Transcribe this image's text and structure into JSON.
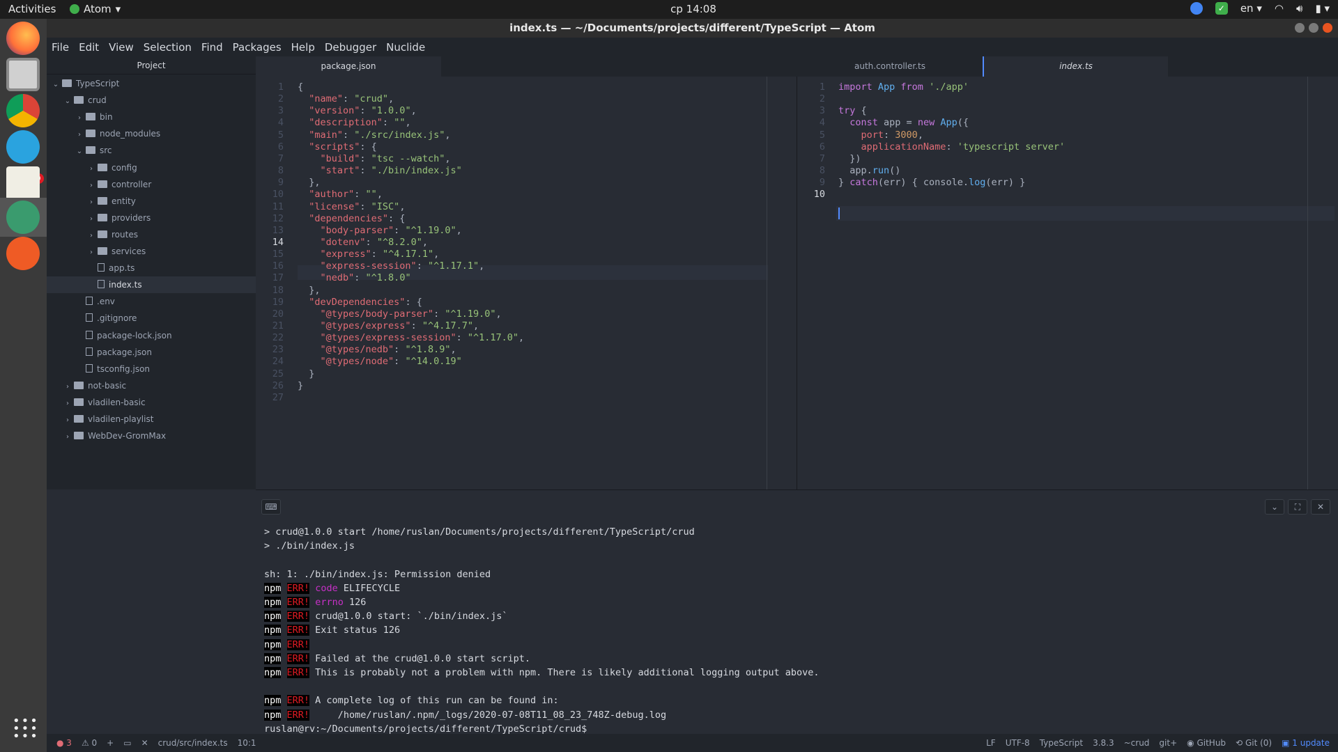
{
  "topbar": {
    "activities": "Activities",
    "app": "Atom",
    "clock": "ср 14:08",
    "lang": "en"
  },
  "window": {
    "title": "index.ts — ~/Documents/projects/different/TypeScript — Atom"
  },
  "dock": {
    "badge": "9999"
  },
  "menu": [
    "File",
    "Edit",
    "View",
    "Selection",
    "Find",
    "Packages",
    "Help",
    "Debugger",
    "Nuclide"
  ],
  "tree": {
    "header": "Project",
    "items": [
      {
        "label": "TypeScript",
        "depth": 0,
        "type": "folder",
        "open": true
      },
      {
        "label": "crud",
        "depth": 1,
        "type": "folder",
        "open": true
      },
      {
        "label": "bin",
        "depth": 2,
        "type": "folder",
        "open": false
      },
      {
        "label": "node_modules",
        "depth": 2,
        "type": "folder",
        "open": false
      },
      {
        "label": "src",
        "depth": 2,
        "type": "folder",
        "open": true
      },
      {
        "label": "config",
        "depth": 3,
        "type": "folder",
        "open": false
      },
      {
        "label": "controller",
        "depth": 3,
        "type": "folder",
        "open": false
      },
      {
        "label": "entity",
        "depth": 3,
        "type": "folder",
        "open": false
      },
      {
        "label": "providers",
        "depth": 3,
        "type": "folder",
        "open": false
      },
      {
        "label": "routes",
        "depth": 3,
        "type": "folder",
        "open": false
      },
      {
        "label": "services",
        "depth": 3,
        "type": "folder",
        "open": false
      },
      {
        "label": "app.ts",
        "depth": 3,
        "type": "file"
      },
      {
        "label": "index.ts",
        "depth": 3,
        "type": "file",
        "selected": true
      },
      {
        "label": ".env",
        "depth": 2,
        "type": "file"
      },
      {
        "label": ".gitignore",
        "depth": 2,
        "type": "file"
      },
      {
        "label": "package-lock.json",
        "depth": 2,
        "type": "file"
      },
      {
        "label": "package.json",
        "depth": 2,
        "type": "file"
      },
      {
        "label": "tsconfig.json",
        "depth": 2,
        "type": "file"
      },
      {
        "label": "not-basic",
        "depth": 1,
        "type": "folder",
        "open": false
      },
      {
        "label": "vladilen-basic",
        "depth": 1,
        "type": "folder",
        "open": false
      },
      {
        "label": "vladilen-playlist",
        "depth": 1,
        "type": "folder",
        "open": false
      },
      {
        "label": "WebDev-GromMax",
        "depth": 1,
        "type": "folder",
        "open": false
      }
    ]
  },
  "tabs": {
    "pane1": [
      "package.json"
    ],
    "pane2": [
      "auth.controller.ts",
      "index.ts"
    ]
  },
  "editor1": {
    "lines": [
      [
        [
          "{",
          "w"
        ]
      ],
      [
        [
          "  \"name\"",
          "p"
        ],
        [
          ": ",
          "w"
        ],
        [
          "\"crud\"",
          "s"
        ],
        [
          ",",
          "w"
        ]
      ],
      [
        [
          "  \"version\"",
          "p"
        ],
        [
          ": ",
          "w"
        ],
        [
          "\"1.0.0\"",
          "s"
        ],
        [
          ",",
          "w"
        ]
      ],
      [
        [
          "  \"description\"",
          "p"
        ],
        [
          ": ",
          "w"
        ],
        [
          "\"\"",
          "s"
        ],
        [
          ",",
          "w"
        ]
      ],
      [
        [
          "  \"main\"",
          "p"
        ],
        [
          ": ",
          "w"
        ],
        [
          "\"./src/index.js\"",
          "s"
        ],
        [
          ",",
          "w"
        ]
      ],
      [
        [
          "  \"scripts\"",
          "p"
        ],
        [
          ": {",
          "w"
        ]
      ],
      [
        [
          "    \"build\"",
          "p"
        ],
        [
          ": ",
          "w"
        ],
        [
          "\"tsc --watch\"",
          "s"
        ],
        [
          ",",
          "w"
        ]
      ],
      [
        [
          "    \"start\"",
          "p"
        ],
        [
          ": ",
          "w"
        ],
        [
          "\"./bin/index.js\"",
          "s"
        ]
      ],
      [
        [
          "  },",
          "w"
        ]
      ],
      [
        [
          "  \"author\"",
          "p"
        ],
        [
          ": ",
          "w"
        ],
        [
          "\"\"",
          "s"
        ],
        [
          ",",
          "w"
        ]
      ],
      [
        [
          "  \"license\"",
          "p"
        ],
        [
          ": ",
          "w"
        ],
        [
          "\"ISC\"",
          "s"
        ],
        [
          ",",
          "w"
        ]
      ],
      [
        [
          "  \"dependencies\"",
          "p"
        ],
        [
          ": {",
          "w"
        ]
      ],
      [
        [
          "    \"body-parser\"",
          "p"
        ],
        [
          ": ",
          "w"
        ],
        [
          "\"^1.19.0\"",
          "s"
        ],
        [
          ",",
          "w"
        ]
      ],
      [
        [
          "    \"dotenv\"",
          "p"
        ],
        [
          ": ",
          "w"
        ],
        [
          "\"^8.2.0\"",
          "s"
        ],
        [
          ",",
          "w"
        ]
      ],
      [
        [
          "    \"express\"",
          "p"
        ],
        [
          ": ",
          "w"
        ],
        [
          "\"^4.17.1\"",
          "s"
        ],
        [
          ",",
          "w"
        ]
      ],
      [
        [
          "    \"express-session\"",
          "p"
        ],
        [
          ": ",
          "w"
        ],
        [
          "\"^1.17.1\"",
          "s"
        ],
        [
          ",",
          "w"
        ]
      ],
      [
        [
          "    \"nedb\"",
          "p"
        ],
        [
          ": ",
          "w"
        ],
        [
          "\"^1.8.0\"",
          "s"
        ]
      ],
      [
        [
          "  },",
          "w"
        ]
      ],
      [
        [
          "  \"devDependencies\"",
          "p"
        ],
        [
          ": {",
          "w"
        ]
      ],
      [
        [
          "    \"@types/body-parser\"",
          "p"
        ],
        [
          ": ",
          "w"
        ],
        [
          "\"^1.19.0\"",
          "s"
        ],
        [
          ",",
          "w"
        ]
      ],
      [
        [
          "    \"@types/express\"",
          "p"
        ],
        [
          ": ",
          "w"
        ],
        [
          "\"^4.17.7\"",
          "s"
        ],
        [
          ",",
          "w"
        ]
      ],
      [
        [
          "    \"@types/express-session\"",
          "p"
        ],
        [
          ": ",
          "w"
        ],
        [
          "\"^1.17.0\"",
          "s"
        ],
        [
          ",",
          "w"
        ]
      ],
      [
        [
          "    \"@types/nedb\"",
          "p"
        ],
        [
          ": ",
          "w"
        ],
        [
          "\"^1.8.9\"",
          "s"
        ],
        [
          ",",
          "w"
        ]
      ],
      [
        [
          "    \"@types/node\"",
          "p"
        ],
        [
          ": ",
          "w"
        ],
        [
          "\"^14.0.19\"",
          "s"
        ]
      ],
      [
        [
          "  }",
          "w"
        ]
      ],
      [
        [
          "}",
          "w"
        ]
      ],
      [
        [
          "",
          "w"
        ]
      ]
    ]
  },
  "editor2": {
    "lines": [
      [
        [
          "import ",
          "k"
        ],
        [
          "App ",
          "c"
        ],
        [
          "from ",
          "k"
        ],
        [
          "'./app'",
          "s"
        ]
      ],
      [
        [
          "",
          "w"
        ]
      ],
      [
        [
          "try ",
          "k"
        ],
        [
          "{",
          "w"
        ]
      ],
      [
        [
          "  const ",
          "k"
        ],
        [
          "app ",
          "w"
        ],
        [
          "= ",
          "w"
        ],
        [
          "new ",
          "k"
        ],
        [
          "App",
          "c"
        ],
        [
          "({",
          "w"
        ]
      ],
      [
        [
          "    port",
          "p"
        ],
        [
          ": ",
          "w"
        ],
        [
          "3000",
          "n"
        ],
        [
          ",",
          "w"
        ]
      ],
      [
        [
          "    applicationName",
          "p"
        ],
        [
          ": ",
          "w"
        ],
        [
          "'typescript server'",
          "s"
        ]
      ],
      [
        [
          "  })",
          "w"
        ]
      ],
      [
        [
          "  app.",
          "w"
        ],
        [
          "run",
          "c"
        ],
        [
          "()",
          "w"
        ]
      ],
      [
        [
          "} ",
          "w"
        ],
        [
          "catch",
          "k"
        ],
        [
          "(err) { console.",
          "w"
        ],
        [
          "log",
          "c"
        ],
        [
          "(err) }",
          "w"
        ]
      ],
      [
        [
          "",
          "w"
        ]
      ]
    ]
  },
  "terminal": {
    "lines": [
      [
        [
          "> crud@1.0.0 start /home/ruslan/Documents/projects/different/TypeScript/crud",
          ""
        ]
      ],
      [
        [
          "> ./bin/index.js",
          ""
        ]
      ],
      [
        [
          "",
          ""
        ]
      ],
      [
        [
          "sh: 1: ./bin/index.js: Permission denied",
          ""
        ]
      ],
      [
        [
          "npm",
          "npm"
        ],
        [
          " ",
          ""
        ],
        [
          "ERR!",
          "err"
        ],
        [
          " ",
          ""
        ],
        [
          "code",
          "mag"
        ],
        [
          " ELIFECYCLE",
          ""
        ]
      ],
      [
        [
          "npm",
          "npm"
        ],
        [
          " ",
          ""
        ],
        [
          "ERR!",
          "err"
        ],
        [
          " ",
          ""
        ],
        [
          "errno",
          "mag"
        ],
        [
          " 126",
          ""
        ]
      ],
      [
        [
          "npm",
          "npm"
        ],
        [
          " ",
          ""
        ],
        [
          "ERR!",
          "err"
        ],
        [
          " crud@1.0.0 start: `./bin/index.js`",
          ""
        ]
      ],
      [
        [
          "npm",
          "npm"
        ],
        [
          " ",
          ""
        ],
        [
          "ERR!",
          "err"
        ],
        [
          " Exit status 126",
          ""
        ]
      ],
      [
        [
          "npm",
          "npm"
        ],
        [
          " ",
          ""
        ],
        [
          "ERR!",
          "err"
        ]
      ],
      [
        [
          "npm",
          "npm"
        ],
        [
          " ",
          ""
        ],
        [
          "ERR!",
          "err"
        ],
        [
          " Failed at the crud@1.0.0 start script.",
          ""
        ]
      ],
      [
        [
          "npm",
          "npm"
        ],
        [
          " ",
          ""
        ],
        [
          "ERR!",
          "err"
        ],
        [
          " This is probably not a problem with npm. There is likely additional logging output above.",
          ""
        ]
      ],
      [
        [
          "",
          ""
        ]
      ],
      [
        [
          "npm",
          "npm"
        ],
        [
          " ",
          ""
        ],
        [
          "ERR!",
          "err"
        ],
        [
          " A complete log of this run can be found in:",
          ""
        ]
      ],
      [
        [
          "npm",
          "npm"
        ],
        [
          " ",
          ""
        ],
        [
          "ERR!",
          "err"
        ],
        [
          "     /home/ruslan/.npm/_logs/2020-07-08T11_08_23_748Z-debug.log",
          ""
        ]
      ],
      [
        [
          "ruslan@rv:~/Documents/projects/different/TypeScript/crud$",
          ""
        ]
      ]
    ]
  },
  "status": {
    "errors": "3",
    "warnings": "0",
    "path": "crud/src/index.ts",
    "pos": "10:1",
    "eol": "LF",
    "enc": "UTF-8",
    "grammar": "TypeScript",
    "version": "3.8.3",
    "crud": "~crud",
    "git": "git+",
    "github": "GitHub",
    "gitlabel": "Git (0)",
    "update": "1 update"
  }
}
